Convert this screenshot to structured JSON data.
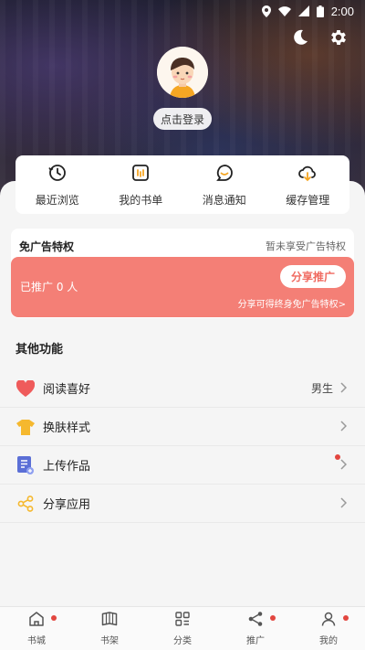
{
  "status_bar": {
    "time": "2:00"
  },
  "profile": {
    "login_label": "点击登录"
  },
  "quick_actions": [
    {
      "label": "最近浏览",
      "icon": "history-icon"
    },
    {
      "label": "我的书单",
      "icon": "booklist-icon"
    },
    {
      "label": "消息通知",
      "icon": "message-icon"
    },
    {
      "label": "缓存管理",
      "icon": "cloud-download-icon"
    }
  ],
  "ad_free": {
    "title": "免广告特权",
    "status": "暂未享受广告特权",
    "promoted_count": "已推广 0 人",
    "share_button": "分享推广",
    "hint": "分享可得终身免广告特权>"
  },
  "other_section": {
    "title": "其他功能",
    "items": [
      {
        "label": "阅读喜好",
        "value": "男生",
        "icon": "heart-icon",
        "dot": false
      },
      {
        "label": "换肤样式",
        "value": "",
        "icon": "tshirt-icon",
        "dot": false
      },
      {
        "label": "上传作品",
        "value": "",
        "icon": "upload-doc-icon",
        "dot": true
      },
      {
        "label": "分享应用",
        "value": "",
        "icon": "share-icon",
        "dot": false
      }
    ]
  },
  "tabbar": [
    {
      "label": "书城",
      "icon": "home-icon",
      "dot": true
    },
    {
      "label": "书架",
      "icon": "bookshelf-icon",
      "dot": false
    },
    {
      "label": "分类",
      "icon": "category-icon",
      "dot": false
    },
    {
      "label": "推广",
      "icon": "share-icon",
      "dot": true
    },
    {
      "label": "我的",
      "icon": "user-icon",
      "dot": true
    }
  ],
  "colors": {
    "accent": "#f47f76",
    "accent_text": "#f06a60",
    "badge": "#e2463f",
    "heart": "#ef5b5b",
    "tshirt": "#f5b82e",
    "upload": "#5b6fd6",
    "share": "#f5b82e"
  }
}
